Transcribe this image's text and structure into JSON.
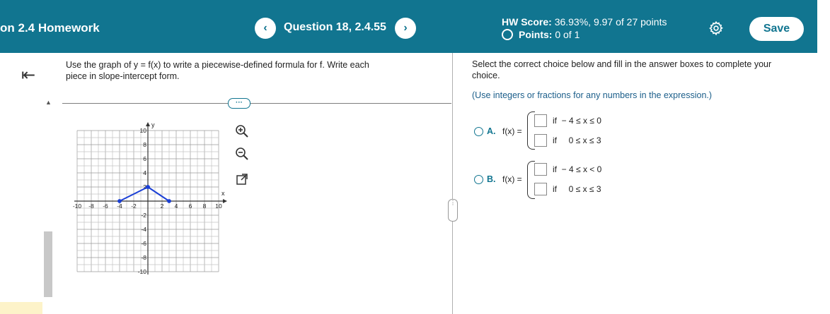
{
  "header": {
    "assignment_title": "on 2.4 Homework",
    "prev_label": "‹",
    "next_label": "›",
    "question_title": "Question 18, 2.4.55",
    "hw_score_label": "HW Score:",
    "hw_score_value": "36.93%, 9.97 of 27 points",
    "points_label": "Points:",
    "points_value": "0 of 1",
    "settings_icon": "gear-icon",
    "save_label": "Save"
  },
  "left": {
    "collapse_icon": "collapse-left-icon",
    "prompt": "Use the graph of y = f(x) to write a piecewise-defined formula for f. Write each piece in slope-intercept form.",
    "more_label": "···",
    "tools": [
      "zoom-in-icon",
      "zoom-out-icon",
      "open-external-icon"
    ]
  },
  "chart_data": {
    "type": "line",
    "x_label": "x",
    "y_label": "y",
    "xlim": [
      -10,
      10
    ],
    "ylim": [
      -10,
      10
    ],
    "grid": true,
    "x_ticks": [
      "-10",
      "-8",
      "-6",
      "-4",
      "-2",
      "2",
      "4",
      "6",
      "8",
      "10"
    ],
    "y_ticks": [
      "10",
      "8",
      "6",
      "4",
      "2",
      "-2",
      "-4",
      "-6",
      "-8",
      "-10"
    ],
    "series": [
      {
        "x": [
          -4,
          0
        ],
        "y": [
          0,
          2
        ],
        "endpoints": [
          "closed",
          "open"
        ]
      },
      {
        "x": [
          0,
          3
        ],
        "y": [
          2,
          0
        ],
        "endpoints": [
          "closed",
          "closed"
        ]
      }
    ],
    "color": "#1a3fd6"
  },
  "right": {
    "instruction": "Select the correct choice below and fill in the answer boxes to complete your choice.",
    "note": "(Use integers or fractions for any numbers in the expression.)",
    "choices": [
      {
        "label": "A.",
        "fx": "f(x) =",
        "cond1": "if  − 4 ≤ x ≤ 0",
        "cond2": "if     0 ≤ x ≤ 3"
      },
      {
        "label": "B.",
        "fx": "f(x) =",
        "cond1": "if  − 4 ≤ x < 0",
        "cond2": "if     0 ≤ x ≤ 3"
      }
    ]
  }
}
